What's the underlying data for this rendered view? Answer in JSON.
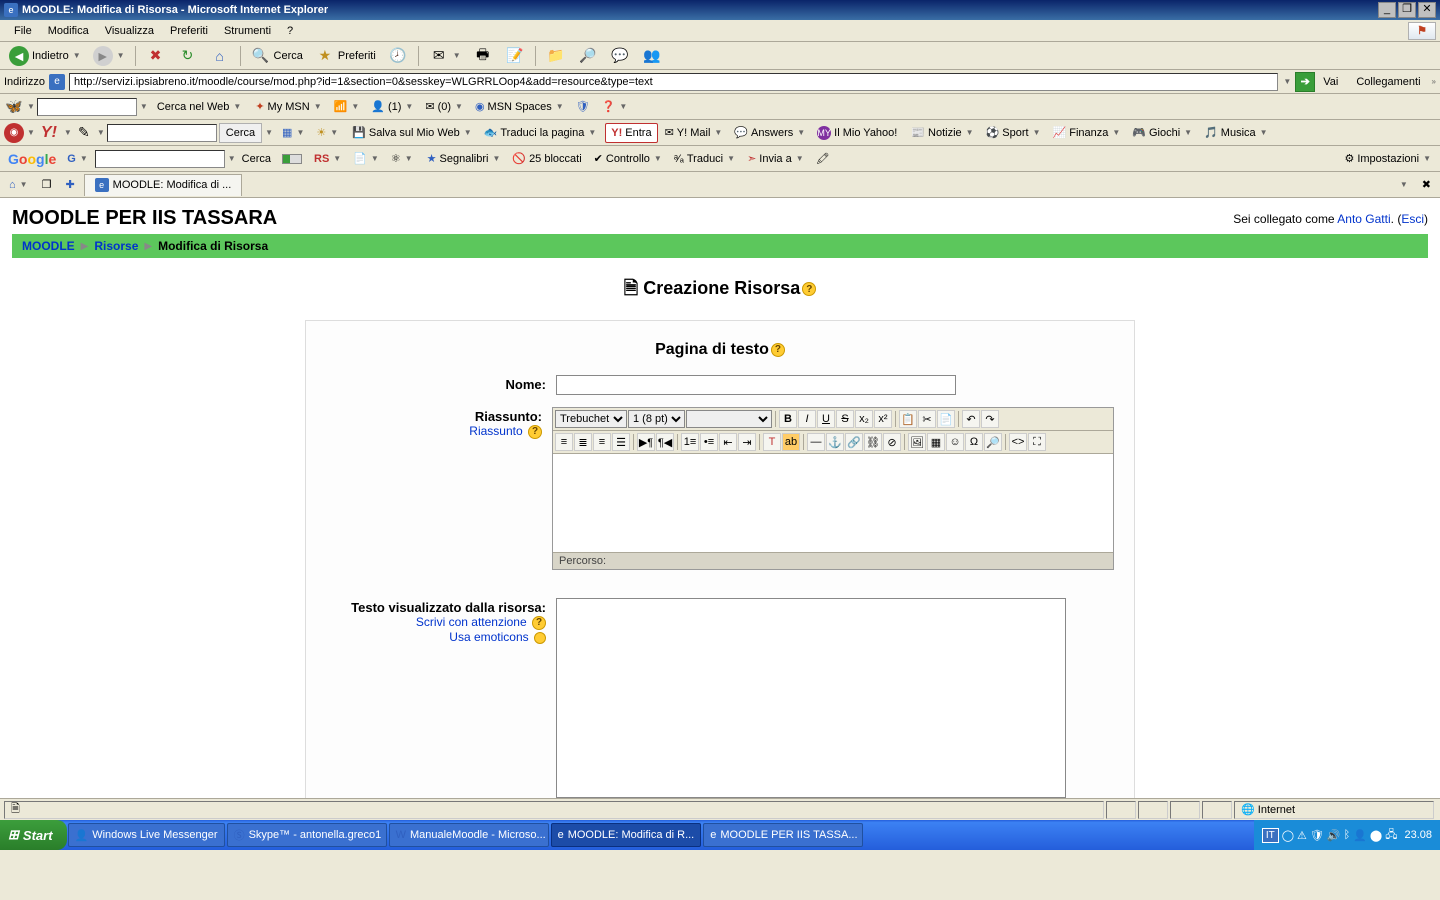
{
  "titlebar": {
    "title": "MOODLE: Modifica di Risorsa - Microsoft Internet Explorer"
  },
  "menubar": {
    "items": [
      "File",
      "Modifica",
      "Visualizza",
      "Preferiti",
      "Strumenti",
      "?"
    ]
  },
  "nav_toolbar": {
    "back": "Indietro",
    "search": "Cerca",
    "favorites": "Preferiti"
  },
  "addressbar": {
    "label": "Indirizzo",
    "url": "http://servizi.ipsiabreno.it/moodle/course/mod.php?id=1&section=0&sesskey=WLGRRLOop4&add=resource&type=text",
    "go": "Vai",
    "links": "Collegamenti"
  },
  "msn_toolbar": {
    "search_btn": "Cerca nel Web",
    "my_msn": "My MSN",
    "counter1": "(1)",
    "counter2": "(0)",
    "spaces": "MSN Spaces"
  },
  "yahoo_toolbar": {
    "cerca": "Cerca",
    "salva": "Salva sul Mio Web",
    "traduci": "Traduci la pagina",
    "entra": "Entra",
    "ymail": "Y! Mail",
    "answers": "Answers",
    "mio_yahoo": "Il Mio Yahoo!",
    "notizie": "Notizie",
    "sport": "Sport",
    "finanza": "Finanza",
    "giochi": "Giochi",
    "musica": "Musica"
  },
  "google_toolbar": {
    "label": "Google",
    "cerca": "Cerca",
    "rs": "RS",
    "segnalibri": "Segnalibri",
    "bloccati": "25 bloccati",
    "controllo": "Controllo",
    "traduci": "Traduci",
    "invia": "Invia a",
    "impostazioni": "Impostazioni"
  },
  "tabrow": {
    "tab1": "MOODLE: Modifica di ..."
  },
  "moodle": {
    "site_title": "MOODLE PER IIS TASSARA",
    "logged_in_prefix": "Sei collegato come ",
    "user": "Anto Gatti",
    "logout": "Esci",
    "breadcrumb": {
      "root": "MOODLE",
      "mid": "Risorse",
      "current": "Modifica di Risorsa"
    },
    "page_title": "Creazione Risorsa",
    "section_title": "Pagina di testo",
    "labels": {
      "nome": "Nome:",
      "riassunto": "Riassunto:",
      "riassunto_link": "Riassunto",
      "testo": "Testo visualizzato dalla risorsa:",
      "scrivi": "Scrivi con attenzione",
      "emoticons": "Usa emoticons"
    },
    "rte": {
      "font": "Trebuchet",
      "size": "1 (8 pt)",
      "path_label": "Percorso:"
    }
  },
  "statusbar": {
    "zone": "Internet"
  },
  "taskbar": {
    "start": "Start",
    "items": [
      "Windows Live Messenger",
      "Skype™ - antonella.greco1",
      "ManualeMoodle - Microso...",
      "MOODLE: Modifica di R...",
      "MOODLE PER IIS TASSA..."
    ],
    "lang": "IT",
    "clock": "23.08"
  }
}
